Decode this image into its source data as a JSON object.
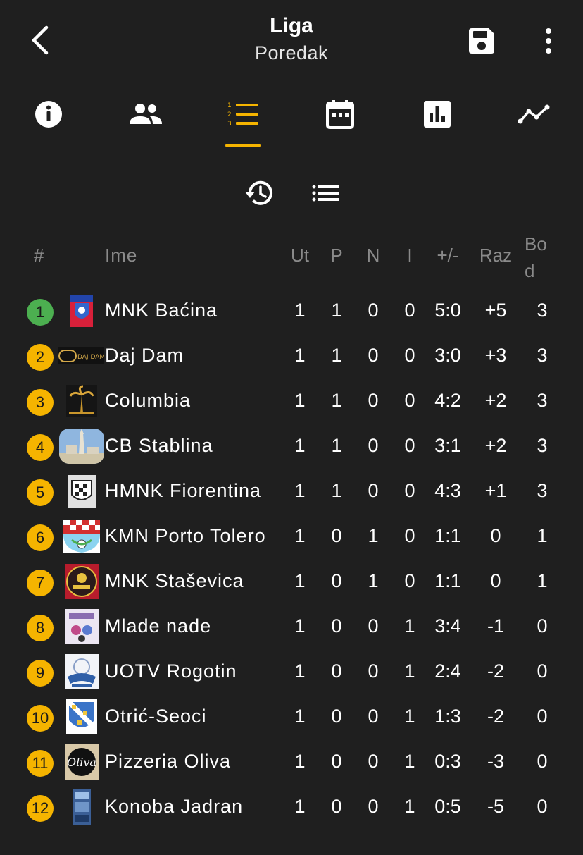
{
  "header": {
    "title": "Liga",
    "subtitle": "Poredak"
  },
  "table": {
    "headers": {
      "rank": "#",
      "name": "Ime",
      "played": "Ut",
      "won": "P",
      "draw": "N",
      "lost": "I",
      "goals": "+/-",
      "diff": "Raz",
      "points": "Bod"
    },
    "rows": [
      {
        "rank": "1",
        "name": "MNK Baćina",
        "ut": "1",
        "p": "1",
        "n": "0",
        "i": "0",
        "goals": "5:0",
        "raz": "+5",
        "bod": "3"
      },
      {
        "rank": "2",
        "name": "Daj Dam",
        "ut": "1",
        "p": "1",
        "n": "0",
        "i": "0",
        "goals": "3:0",
        "raz": "+3",
        "bod": "3"
      },
      {
        "rank": "3",
        "name": "Columbia",
        "ut": "1",
        "p": "1",
        "n": "0",
        "i": "0",
        "goals": "4:2",
        "raz": "+2",
        "bod": "3"
      },
      {
        "rank": "4",
        "name": "CB Stablina",
        "ut": "1",
        "p": "1",
        "n": "0",
        "i": "0",
        "goals": "3:1",
        "raz": "+2",
        "bod": "3"
      },
      {
        "rank": "5",
        "name": "HMNK Fiorentina",
        "ut": "1",
        "p": "1",
        "n": "0",
        "i": "0",
        "goals": "4:3",
        "raz": "+1",
        "bod": "3"
      },
      {
        "rank": "6",
        "name": "KMN Porto Tolero",
        "ut": "1",
        "p": "0",
        "n": "1",
        "i": "0",
        "goals": "1:1",
        "raz": "0",
        "bod": "1"
      },
      {
        "rank": "7",
        "name": "MNK Staševica",
        "ut": "1",
        "p": "0",
        "n": "1",
        "i": "0",
        "goals": "1:1",
        "raz": "0",
        "bod": "1"
      },
      {
        "rank": "8",
        "name": "Mlade nade",
        "ut": "1",
        "p": "0",
        "n": "0",
        "i": "1",
        "goals": "3:4",
        "raz": "-1",
        "bod": "0"
      },
      {
        "rank": "9",
        "name": "UOTV Rogotin",
        "ut": "1",
        "p": "0",
        "n": "0",
        "i": "1",
        "goals": "2:4",
        "raz": "-2",
        "bod": "0"
      },
      {
        "rank": "10",
        "name": "Otrić-Seoci",
        "ut": "1",
        "p": "0",
        "n": "0",
        "i": "1",
        "goals": "1:3",
        "raz": "-2",
        "bod": "0"
      },
      {
        "rank": "11",
        "name": "Pizzeria Oliva",
        "ut": "1",
        "p": "0",
        "n": "0",
        "i": "1",
        "goals": "0:3",
        "raz": "-3",
        "bod": "0"
      },
      {
        "rank": "12",
        "name": "Konoba Jadran",
        "ut": "1",
        "p": "0",
        "n": "0",
        "i": "1",
        "goals": "0:5",
        "raz": "-5",
        "bod": "0"
      }
    ]
  },
  "logos": {
    "daj_dam_text": "DAJ DAM",
    "oliva_text": "Oliva"
  },
  "colors": {
    "background": "#1f1f1f",
    "accent": "#f5b400",
    "leader": "#4caf50",
    "muted": "#8a8a8a"
  },
  "icons": {
    "back": "chevron-left-icon",
    "save": "floppy-disk-icon",
    "more": "more-vertical-icon",
    "tabs": [
      "info-icon",
      "people-icon",
      "ordered-list-icon",
      "calendar-icon",
      "bar-chart-icon",
      "trend-line-icon"
    ],
    "subtools": [
      "history-icon",
      "list-icon"
    ]
  }
}
